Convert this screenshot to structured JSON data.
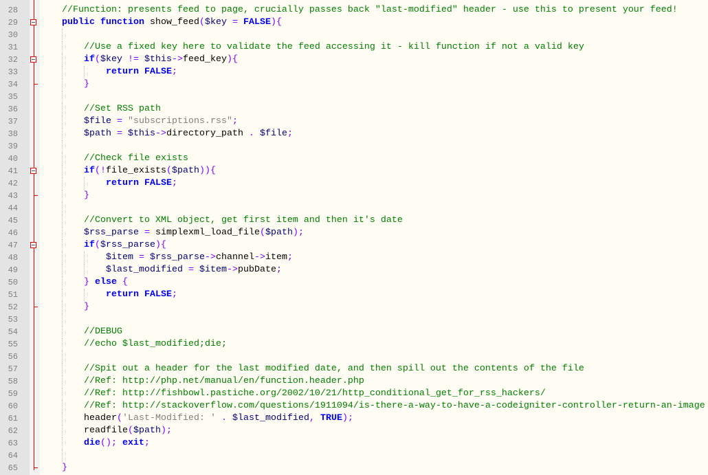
{
  "editor": {
    "colors": {
      "background": "#fffcf3",
      "comment": "#008000",
      "keyword": "#0000ff",
      "variable": "#000080",
      "operator": "#8000ff",
      "string": "#808080",
      "fold_marker": "#e00000"
    },
    "lines": [
      {
        "n": "28",
        "indent": 1,
        "t": [
          [
            "c",
            "//Function: presents feed to page, crucially passes back \"last-modified\" header - use this to present your feed!"
          ]
        ]
      },
      {
        "n": "29",
        "indent": 1,
        "fold": "start",
        "t": [
          [
            "k",
            "public"
          ],
          [
            "p",
            " "
          ],
          [
            "k",
            "function"
          ],
          [
            "p",
            " show_feed"
          ],
          [
            "o",
            "("
          ],
          [
            "v",
            "$key"
          ],
          [
            "p",
            " "
          ],
          [
            "o",
            "="
          ],
          [
            "p",
            " "
          ],
          [
            "k",
            "FALSE"
          ],
          [
            "o",
            "){"
          ]
        ]
      },
      {
        "n": "30",
        "indent": 0,
        "t": []
      },
      {
        "n": "31",
        "indent": 2,
        "t": [
          [
            "c",
            "//Use a fixed key here to validate the feed accessing it - kill function if not a valid key"
          ]
        ]
      },
      {
        "n": "32",
        "indent": 2,
        "fold": "start",
        "t": [
          [
            "k",
            "if"
          ],
          [
            "o",
            "("
          ],
          [
            "v",
            "$key"
          ],
          [
            "p",
            " "
          ],
          [
            "o",
            "!="
          ],
          [
            "p",
            " "
          ],
          [
            "v",
            "$this"
          ],
          [
            "o",
            "->"
          ],
          [
            "p",
            "feed_key"
          ],
          [
            "o",
            "){"
          ]
        ]
      },
      {
        "n": "33",
        "indent": 3,
        "t": [
          [
            "k",
            "return"
          ],
          [
            "p",
            " "
          ],
          [
            "k",
            "FALSE"
          ],
          [
            "o",
            ";"
          ]
        ]
      },
      {
        "n": "34",
        "indent": 2,
        "fold": "end",
        "t": [
          [
            "o",
            "}"
          ]
        ]
      },
      {
        "n": "35",
        "indent": 0,
        "t": []
      },
      {
        "n": "36",
        "indent": 2,
        "t": [
          [
            "c",
            "//Set RSS path"
          ]
        ]
      },
      {
        "n": "37",
        "indent": 2,
        "t": [
          [
            "v",
            "$file"
          ],
          [
            "p",
            " "
          ],
          [
            "o",
            "="
          ],
          [
            "p",
            " "
          ],
          [
            "s",
            "\"subscriptions.rss\""
          ],
          [
            "o",
            ";"
          ]
        ]
      },
      {
        "n": "38",
        "indent": 2,
        "t": [
          [
            "v",
            "$path"
          ],
          [
            "p",
            " "
          ],
          [
            "o",
            "="
          ],
          [
            "p",
            " "
          ],
          [
            "v",
            "$this"
          ],
          [
            "o",
            "->"
          ],
          [
            "p",
            "directory_path "
          ],
          [
            "o",
            "."
          ],
          [
            "p",
            " "
          ],
          [
            "v",
            "$file"
          ],
          [
            "o",
            ";"
          ]
        ]
      },
      {
        "n": "39",
        "indent": 0,
        "t": []
      },
      {
        "n": "40",
        "indent": 2,
        "t": [
          [
            "c",
            "//Check file exists"
          ]
        ]
      },
      {
        "n": "41",
        "indent": 2,
        "fold": "start",
        "t": [
          [
            "k",
            "if"
          ],
          [
            "o",
            "(!"
          ],
          [
            "f",
            "file_exists"
          ],
          [
            "o",
            "("
          ],
          [
            "v",
            "$path"
          ],
          [
            "o",
            ")){"
          ]
        ]
      },
      {
        "n": "42",
        "indent": 3,
        "t": [
          [
            "k",
            "return"
          ],
          [
            "p",
            " "
          ],
          [
            "k",
            "FALSE"
          ],
          [
            "o",
            ";"
          ]
        ]
      },
      {
        "n": "43",
        "indent": 2,
        "fold": "end",
        "t": [
          [
            "o",
            "}"
          ]
        ]
      },
      {
        "n": "44",
        "indent": 0,
        "t": []
      },
      {
        "n": "45",
        "indent": 2,
        "t": [
          [
            "c",
            "//Convert to XML object, get first item and then it's date"
          ]
        ]
      },
      {
        "n": "46",
        "indent": 2,
        "t": [
          [
            "v",
            "$rss_parse"
          ],
          [
            "p",
            " "
          ],
          [
            "o",
            "="
          ],
          [
            "p",
            " simplexml_load_file"
          ],
          [
            "o",
            "("
          ],
          [
            "v",
            "$path"
          ],
          [
            "o",
            ");"
          ]
        ]
      },
      {
        "n": "47",
        "indent": 2,
        "fold": "start",
        "t": [
          [
            "k",
            "if"
          ],
          [
            "o",
            "("
          ],
          [
            "v",
            "$rss_parse"
          ],
          [
            "o",
            "){"
          ]
        ]
      },
      {
        "n": "48",
        "indent": 3,
        "t": [
          [
            "v",
            "$item"
          ],
          [
            "p",
            " "
          ],
          [
            "o",
            "="
          ],
          [
            "p",
            " "
          ],
          [
            "v",
            "$rss_parse"
          ],
          [
            "o",
            "->"
          ],
          [
            "p",
            "channel"
          ],
          [
            "o",
            "->"
          ],
          [
            "p",
            "item"
          ],
          [
            "o",
            ";"
          ]
        ]
      },
      {
        "n": "49",
        "indent": 3,
        "t": [
          [
            "v",
            "$last_modified"
          ],
          [
            "p",
            " "
          ],
          [
            "o",
            "="
          ],
          [
            "p",
            " "
          ],
          [
            "v",
            "$item"
          ],
          [
            "o",
            "->"
          ],
          [
            "p",
            "pubDate"
          ],
          [
            "o",
            ";"
          ]
        ]
      },
      {
        "n": "50",
        "indent": 2,
        "t": [
          [
            "o",
            "}"
          ],
          [
            "p",
            " "
          ],
          [
            "k",
            "else"
          ],
          [
            "p",
            " "
          ],
          [
            "o",
            "{"
          ]
        ]
      },
      {
        "n": "51",
        "indent": 3,
        "t": [
          [
            "k",
            "return"
          ],
          [
            "p",
            " "
          ],
          [
            "k",
            "FALSE"
          ],
          [
            "o",
            ";"
          ]
        ]
      },
      {
        "n": "52",
        "indent": 2,
        "fold": "end",
        "t": [
          [
            "o",
            "}"
          ]
        ]
      },
      {
        "n": "53",
        "indent": 0,
        "t": []
      },
      {
        "n": "54",
        "indent": 2,
        "t": [
          [
            "c",
            "//DEBUG"
          ]
        ]
      },
      {
        "n": "55",
        "indent": 2,
        "t": [
          [
            "c",
            "//echo $last_modified;die;"
          ]
        ]
      },
      {
        "n": "56",
        "indent": 0,
        "t": []
      },
      {
        "n": "57",
        "indent": 2,
        "t": [
          [
            "c",
            "//Spit out a header for the last modified date, and then spill out the contents of the file"
          ]
        ]
      },
      {
        "n": "58",
        "indent": 2,
        "t": [
          [
            "c",
            "//Ref: http://php.net/manual/en/function.header.php"
          ]
        ]
      },
      {
        "n": "59",
        "indent": 2,
        "t": [
          [
            "c",
            "//Ref: http://fishbowl.pastiche.org/2002/10/21/http_conditional_get_for_rss_hackers/"
          ]
        ]
      },
      {
        "n": "60",
        "indent": 2,
        "t": [
          [
            "c",
            "//Ref: http://stackoverflow.com/questions/1911094/is-there-a-way-to-have-a-codeigniter-controller-return-an-image"
          ]
        ]
      },
      {
        "n": "61",
        "indent": 2,
        "t": [
          [
            "f",
            "header"
          ],
          [
            "o",
            "("
          ],
          [
            "s",
            "'Last-Modified: '"
          ],
          [
            "p",
            " "
          ],
          [
            "o",
            "."
          ],
          [
            "p",
            " "
          ],
          [
            "v",
            "$last_modified"
          ],
          [
            "o",
            ","
          ],
          [
            "p",
            " "
          ],
          [
            "k",
            "TRUE"
          ],
          [
            "o",
            ");"
          ]
        ]
      },
      {
        "n": "62",
        "indent": 2,
        "t": [
          [
            "f",
            "readfile"
          ],
          [
            "o",
            "("
          ],
          [
            "v",
            "$path"
          ],
          [
            "o",
            ");"
          ]
        ]
      },
      {
        "n": "63",
        "indent": 2,
        "t": [
          [
            "k",
            "die"
          ],
          [
            "o",
            "();"
          ],
          [
            "p",
            " "
          ],
          [
            "k",
            "exit"
          ],
          [
            "o",
            ";"
          ]
        ]
      },
      {
        "n": "64",
        "indent": 0,
        "t": []
      },
      {
        "n": "65",
        "indent": 1,
        "fold": "end",
        "t": [
          [
            "o",
            "}"
          ]
        ]
      }
    ]
  }
}
